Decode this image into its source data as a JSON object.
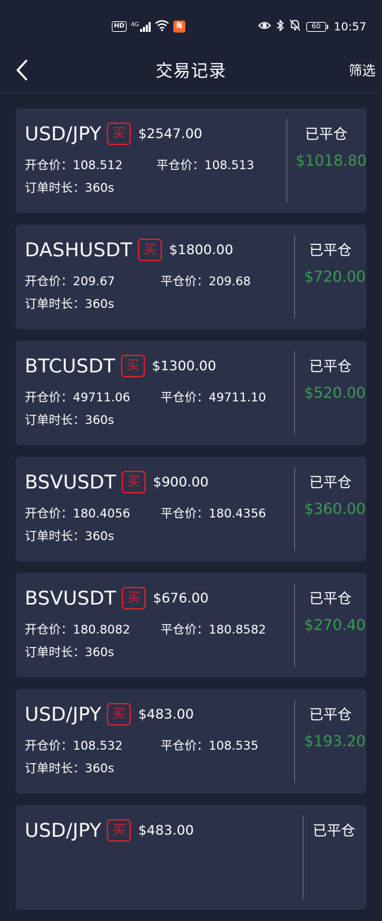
{
  "status_bar": {
    "hd": "HD",
    "network": "4G",
    "battery": "60",
    "time": "10:57"
  },
  "nav": {
    "title": "交易记录",
    "filter_label": "筛选"
  },
  "labels": {
    "open_price": "开仓价：",
    "close_price": "平仓价：",
    "duration": "订单时长："
  },
  "orders": [
    {
      "symbol": "USD/JPY",
      "side": "买",
      "amount": "$2547.00",
      "open": "108.512",
      "close": "108.513",
      "duration": "360s",
      "status": "已平仓",
      "profit": "$1018.80"
    },
    {
      "symbol": "DASHUSDT",
      "side": "买",
      "amount": "$1800.00",
      "open": "209.67",
      "close": "209.68",
      "duration": "360s",
      "status": "已平仓",
      "profit": "$720.00"
    },
    {
      "symbol": "BTCUSDT",
      "side": "买",
      "amount": "$1300.00",
      "open": "49711.06",
      "close": "49711.10",
      "duration": "360s",
      "status": "已平仓",
      "profit": "$520.00"
    },
    {
      "symbol": "BSVUSDT",
      "side": "买",
      "amount": "$900.00",
      "open": "180.4056",
      "close": "180.4356",
      "duration": "360s",
      "status": "已平仓",
      "profit": "$360.00"
    },
    {
      "symbol": "BSVUSDT",
      "side": "买",
      "amount": "$676.00",
      "open": "180.8082",
      "close": "180.8582",
      "duration": "360s",
      "status": "已平仓",
      "profit": "$270.40"
    },
    {
      "symbol": "USD/JPY",
      "side": "买",
      "amount": "$483.00",
      "open": "108.532",
      "close": "108.535",
      "duration": "360s",
      "status": "已平仓",
      "profit": "$193.20"
    },
    {
      "symbol": "USD/JPY",
      "side": "买",
      "amount": "$483.00",
      "status": "已平仓"
    }
  ],
  "colors": {
    "background": "#1c2133",
    "card": "#2b3148",
    "buy": "#d1232e",
    "profit": "#3c9a53"
  }
}
